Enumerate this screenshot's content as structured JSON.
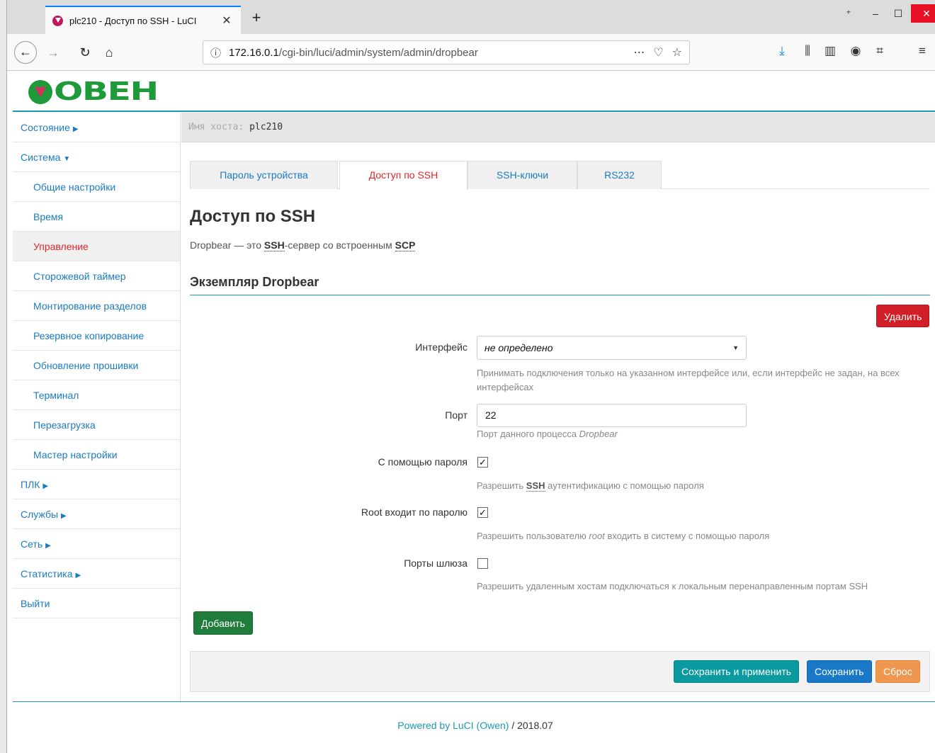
{
  "browser": {
    "tab_title": "plc210 - Доступ по SSH - LuCI",
    "url_host": "172.16.0.1",
    "url_path": "/cgi-bin/luci/admin/system/admin/dropbear"
  },
  "header": {
    "logo_text": "ОВЕН"
  },
  "hostbar": {
    "label": "Имя хоста:",
    "value": "plc210"
  },
  "sidebar": {
    "items": [
      {
        "label": "Состояние",
        "caret": "▶"
      },
      {
        "label": "Система",
        "caret": "▼"
      },
      {
        "label": "Общие настройки"
      },
      {
        "label": "Время"
      },
      {
        "label": "Управление"
      },
      {
        "label": "Сторожевой таймер"
      },
      {
        "label": "Монтирование разделов"
      },
      {
        "label": "Резервное копирование"
      },
      {
        "label": "Обновление прошивки"
      },
      {
        "label": "Терминал"
      },
      {
        "label": "Перезагрузка"
      },
      {
        "label": "Мастер настройки"
      },
      {
        "label": "ПЛК",
        "caret": "▶"
      },
      {
        "label": "Службы",
        "caret": "▶"
      },
      {
        "label": "Сеть",
        "caret": "▶"
      },
      {
        "label": "Статистика",
        "caret": "▶"
      },
      {
        "label": "Выйти"
      }
    ]
  },
  "tabs": [
    {
      "label": "Пароль устройства"
    },
    {
      "label": "Доступ по SSH"
    },
    {
      "label": "SSH-ключи"
    },
    {
      "label": "RS232"
    }
  ],
  "page": {
    "title": "Доступ по SSH",
    "desc_prefix": "Dropbear — это ",
    "desc_ssh": "SSH",
    "desc_middle": "-сервер со встроенным ",
    "desc_scp": "SCP",
    "section_title": "Экземпляр Dropbear"
  },
  "buttons": {
    "delete": "Удалить",
    "add": "Добавить",
    "save_apply": "Сохранить и применить",
    "save": "Сохранить",
    "reset": "Сброс"
  },
  "form": {
    "interface": {
      "label": "Интерфейс",
      "value": "не определено",
      "hint": "Принимать подключения только на указанном интерфейсе или, если интерфейс не задан, на всех интерфейсах"
    },
    "port": {
      "label": "Порт",
      "value": "22",
      "hint_prefix": "Порт данного процесса ",
      "hint_italic": "Dropbear"
    },
    "password_auth": {
      "label": "С помощью пароля",
      "checked": true,
      "hint_prefix": "Разрешить ",
      "hint_abbr": "SSH",
      "hint_suffix": " аутентификацию с помощью пароля"
    },
    "root_password": {
      "label": "Root входит по паролю",
      "checked": true,
      "hint_prefix": "Разрешить пользователю ",
      "hint_italic": "root",
      "hint_suffix": " входить в систему с помощью пароля"
    },
    "gateway_ports": {
      "label": "Порты шлюза",
      "checked": false,
      "hint": "Разрешить удаленным хостам подключаться к локальным перенаправленным портам SSH"
    }
  },
  "footer": {
    "link": "Powered by LuCI (Owen)",
    "version": " / 2018.07"
  },
  "colors": {
    "accent": "#1a9bb0",
    "link": "#1b7bc1",
    "active": "#e0262a",
    "delete": "#d21e26",
    "add": "#1f7c3a",
    "save_apply": "#0a9aa0",
    "save": "#1979c8",
    "reset": "#f0974f"
  }
}
